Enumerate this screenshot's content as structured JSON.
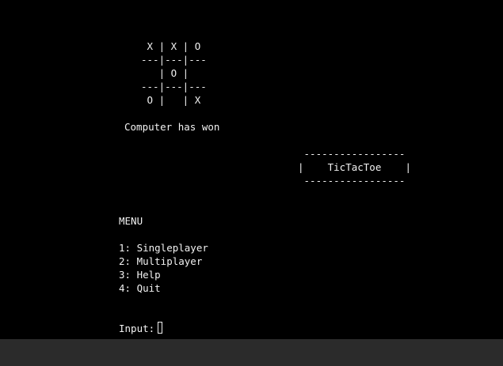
{
  "board": {
    "row1": " X | X | O",
    "divider1": "---|---|---",
    "row2": "   | O |",
    "divider2": "---|---|---",
    "row3": " O |   | X"
  },
  "status": "Computer has won",
  "banner": {
    "top": " -----------------",
    "title": "|    TicTacToe    |",
    "bottom": " -----------------"
  },
  "menu": {
    "heading": "MENU",
    "items": [
      "1: Singleplayer",
      "2: Multiplayer",
      "3: Help",
      "4: Quit"
    ]
  },
  "input": {
    "prompt": "Input:"
  },
  "colors": {
    "background": "#000000",
    "text": "#f2f2f2",
    "taskbar": "#2b2b2b"
  }
}
